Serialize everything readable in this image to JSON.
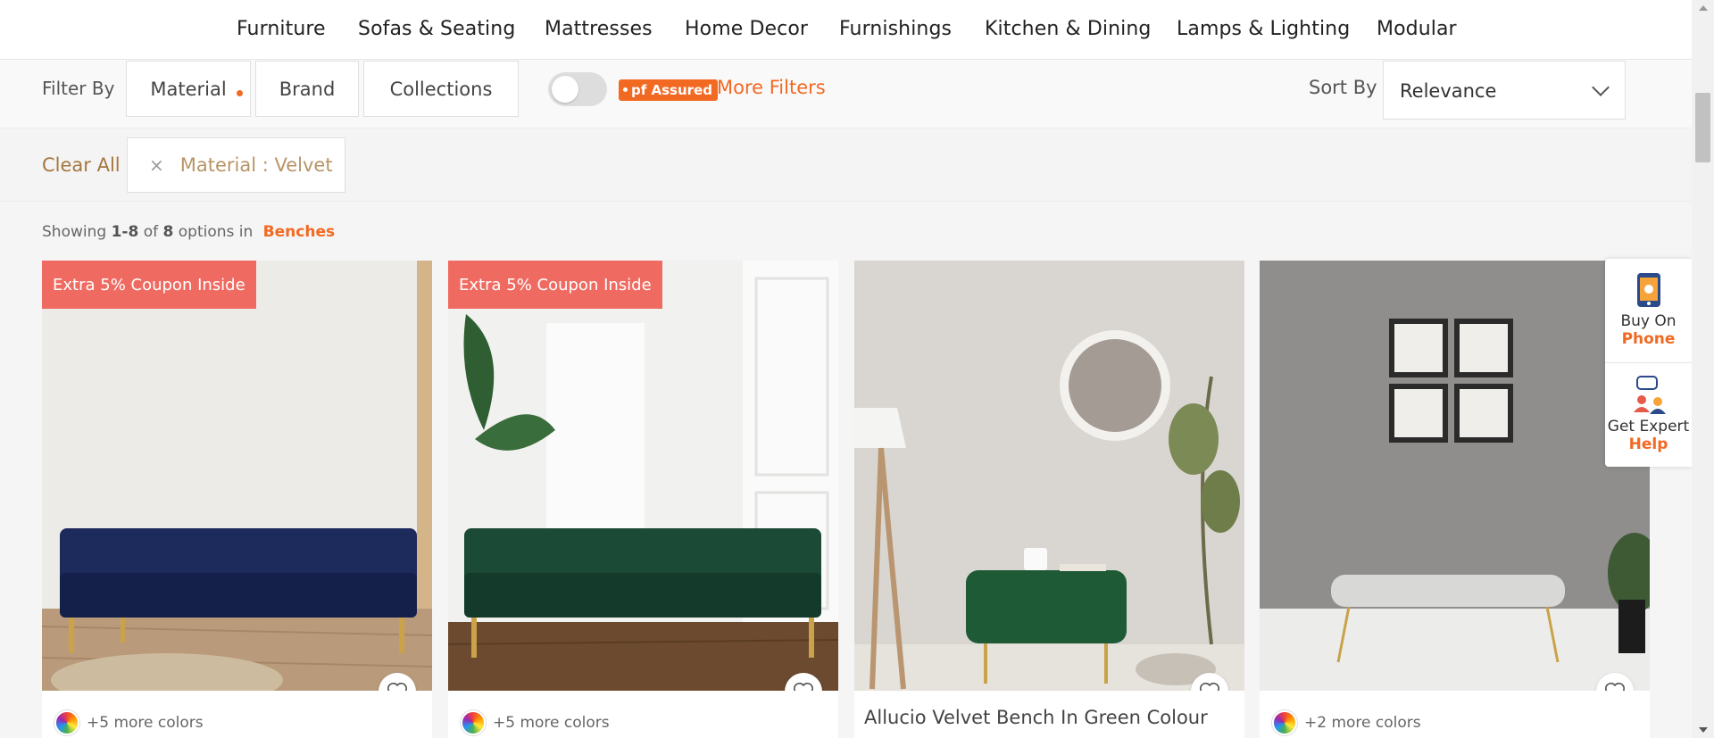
{
  "nav": {
    "items": [
      "Furniture",
      "Sofas & Seating",
      "Mattresses",
      "Home Decor",
      "Furnishings",
      "Kitchen & Dining",
      "Lamps & Lighting",
      "Modular"
    ]
  },
  "filters": {
    "label": "Filter By",
    "buttons": [
      "Material",
      "Brand",
      "Collections"
    ],
    "assured_badge": "pf Assured",
    "more_filters": "More Filters",
    "sort_label": "Sort By",
    "sort_value": "Relevance"
  },
  "active_filters": {
    "clear_all": "Clear All",
    "chip_close": "×",
    "chip": "Material : Velvet"
  },
  "results": {
    "prefix": "Showing",
    "range": "1-8",
    "of": "of",
    "total": "8",
    "suffix": "options in",
    "category": "Benches"
  },
  "products": [
    {
      "coupon": "Extra 5% Coupon Inside",
      "colors": "+5 more colors",
      "color_hex": "#1d2a5c"
    },
    {
      "coupon": "Extra 5% Coupon Inside",
      "colors": "+5 more colors",
      "color_hex": "#1b4a36"
    },
    {
      "name": "Allucio Velvet Bench In Green Colour",
      "color_hex": "#1f5a37"
    },
    {
      "colors": "+2 more colors",
      "color_hex": "#d8d8d6"
    }
  ],
  "help": {
    "phone_line1": "Buy On",
    "phone_line2": "Phone",
    "expert_line1": "Get Expert",
    "expert_line2": "Help"
  },
  "colors": {
    "accent": "#f26922",
    "coupon": "#ef6b62",
    "chip_text": "#b89467"
  }
}
